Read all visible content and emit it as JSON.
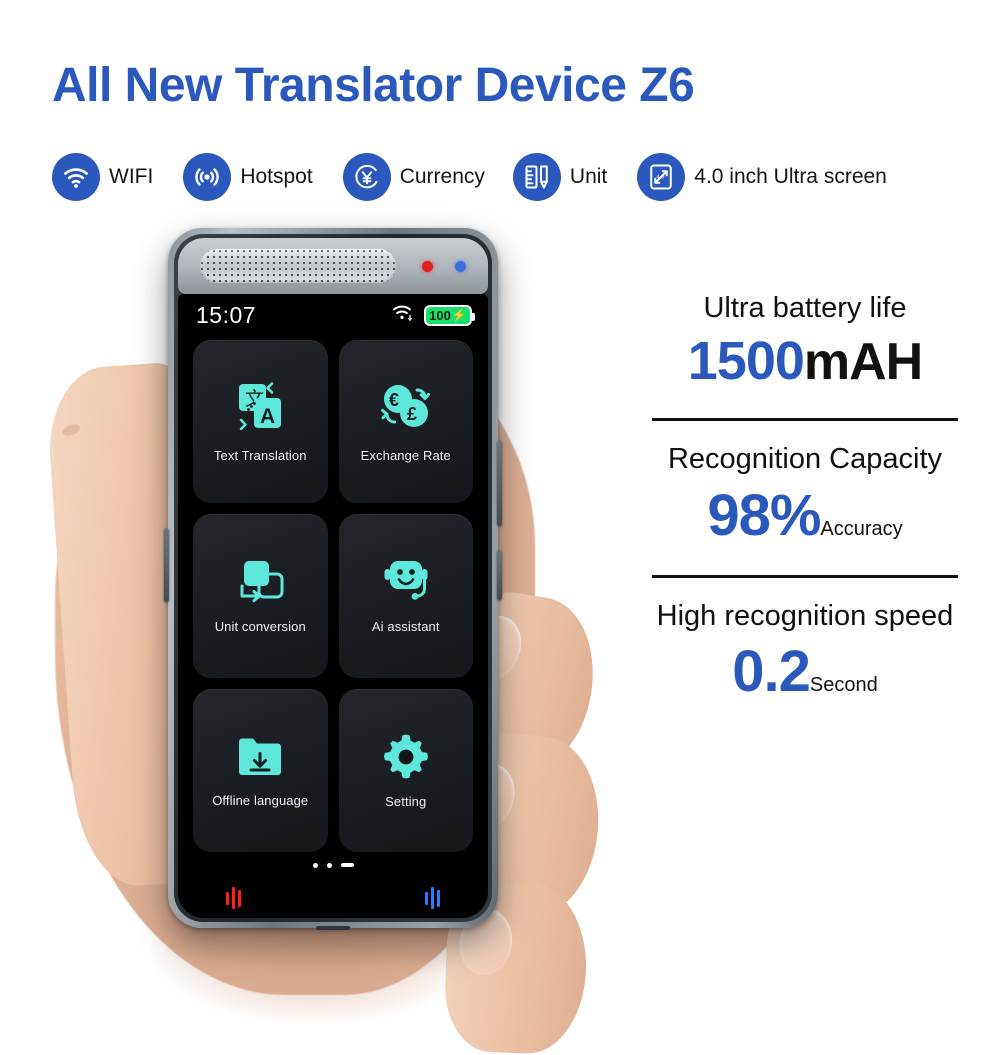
{
  "headline": "All New Translator Device Z6",
  "badges": [
    {
      "icon": "wifi-icon",
      "label": "WIFI"
    },
    {
      "icon": "hotspot-icon",
      "label": "Hotspot"
    },
    {
      "icon": "currency-yen-icon",
      "label": "Currency"
    },
    {
      "icon": "unit-ruler-icon",
      "label": "Unit"
    },
    {
      "icon": "screen-size-icon",
      "label": "4.0 inch Ultra screen",
      "badge_text": "4.0"
    }
  ],
  "device": {
    "status_bar": {
      "time": "15:07",
      "wifi_icon": "wifi-icon",
      "data-transfer-icon": "data-transfer-icon",
      "battery_level": "100",
      "battery_charging_icon": "bolt-icon"
    },
    "apps": [
      {
        "id": "text-translation",
        "label": "Text Translation",
        "icon": "translate-icon"
      },
      {
        "id": "exchange-rate",
        "label": "Exchange Rate",
        "icon": "currency-exchange-icon"
      },
      {
        "id": "unit-conversion",
        "label": "Unit conversion",
        "icon": "unit-conversion-icon"
      },
      {
        "id": "ai-assistant",
        "label": "Ai assistant",
        "icon": "robot-icon"
      },
      {
        "id": "offline-language",
        "label": "Offline language",
        "icon": "folder-download-icon"
      },
      {
        "id": "setting",
        "label": "Setting",
        "icon": "gear-icon"
      }
    ],
    "page_indicator": {
      "dots": 2,
      "active_dash": 1
    },
    "mic_left_icon": "record-waveform-red-icon",
    "mic_right_icon": "record-waveform-blue-icon"
  },
  "specs": [
    {
      "title": "Ultra battery life",
      "value": "1500",
      "unit": "mAH",
      "unit_style": "large"
    },
    {
      "title": "Recognition Capacity",
      "value": "98%",
      "unit": "Accuracy",
      "unit_style": "small"
    },
    {
      "title": "High recognition speed",
      "value": "0.2",
      "unit": "Second",
      "unit_style": "small"
    }
  ],
  "colors": {
    "brand_blue": "#2B58BC",
    "accent_turquoise": "#5EE8DC",
    "battery_green": "#18E06A",
    "mic_red": "#FF1F1F",
    "mic_blue": "#2B7BFF"
  }
}
